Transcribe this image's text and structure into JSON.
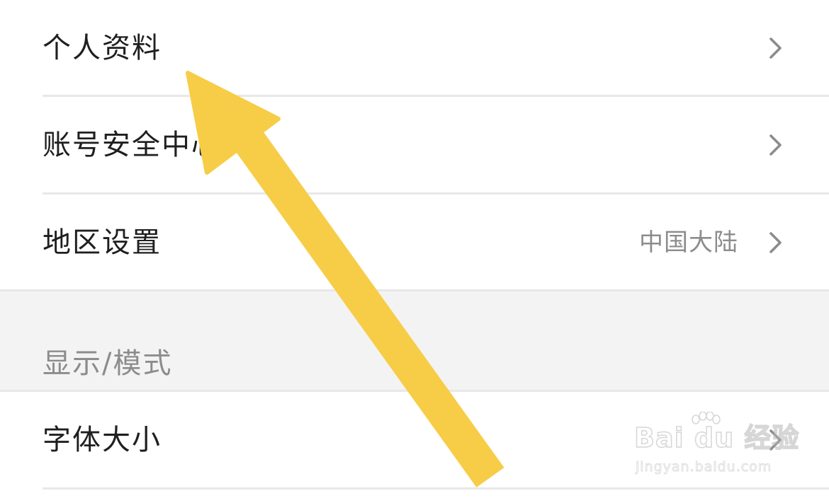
{
  "settings": {
    "rows": [
      {
        "label": "个人资料",
        "value": ""
      },
      {
        "label": "账号安全中心",
        "value": ""
      },
      {
        "label": "地区设置",
        "value": "中国大陆"
      }
    ],
    "section_title": "显示/模式",
    "display_rows": [
      {
        "label": "字体大小",
        "value": ""
      }
    ]
  },
  "overlay": {
    "arrow_color": "#F7CD47",
    "arrow_icon": "arrow-up-left-icon"
  },
  "watermark": {
    "brand": "Bai du 经验",
    "url": "jingyan.baidu.com"
  }
}
